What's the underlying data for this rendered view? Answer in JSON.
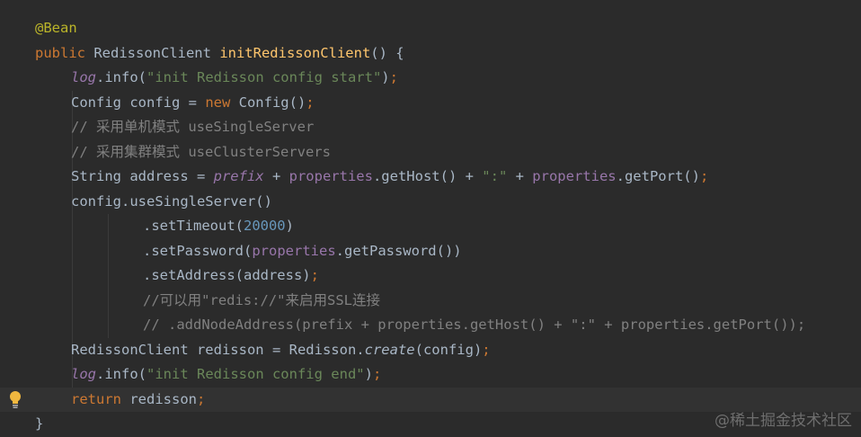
{
  "editor": {
    "lines": [
      {
        "indent": 0,
        "guides": 0,
        "tokens": [
          {
            "t": "@Bean",
            "c": "ann"
          }
        ]
      },
      {
        "indent": 0,
        "guides": 0,
        "tokens": [
          {
            "t": "public ",
            "c": "kw"
          },
          {
            "t": "RedissonClient ",
            "c": "plain"
          },
          {
            "t": "initRedissonClient",
            "c": "fn"
          },
          {
            "t": "() {",
            "c": "plain"
          }
        ]
      },
      {
        "indent": 1,
        "guides": 0,
        "tokens": [
          {
            "t": "log",
            "c": "fldi"
          },
          {
            "t": ".info(",
            "c": "plain"
          },
          {
            "t": "\"init Redisson config start\"",
            "c": "str"
          },
          {
            "t": ")",
            "c": "plain"
          },
          {
            "t": ";",
            "c": "kw"
          }
        ]
      },
      {
        "indent": 1,
        "guides": 1,
        "tokens": [
          {
            "t": "Config config = ",
            "c": "plain"
          },
          {
            "t": "new ",
            "c": "kw"
          },
          {
            "t": "Config()",
            "c": "plain"
          },
          {
            "t": ";",
            "c": "kw"
          }
        ]
      },
      {
        "indent": 1,
        "guides": 1,
        "tokens": [
          {
            "t": "// 采用单机模式 useSingleServer",
            "c": "cmt"
          }
        ]
      },
      {
        "indent": 1,
        "guides": 1,
        "tokens": [
          {
            "t": "// 采用集群模式 useClusterServers",
            "c": "cmt"
          }
        ]
      },
      {
        "indent": 1,
        "guides": 1,
        "tokens": [
          {
            "t": "String address = ",
            "c": "plain"
          },
          {
            "t": "prefix",
            "c": "fldi"
          },
          {
            "t": " + ",
            "c": "plain"
          },
          {
            "t": "properties",
            "c": "fld"
          },
          {
            "t": ".getHost() + ",
            "c": "plain"
          },
          {
            "t": "\":\"",
            "c": "str"
          },
          {
            "t": " + ",
            "c": "plain"
          },
          {
            "t": "properties",
            "c": "fld"
          },
          {
            "t": ".getPort()",
            "c": "plain"
          },
          {
            "t": ";",
            "c": "kw"
          }
        ]
      },
      {
        "indent": 1,
        "guides": 1,
        "tokens": [
          {
            "t": "config.useSingleServer()",
            "c": "plain"
          }
        ]
      },
      {
        "indent": 3,
        "guides": 2,
        "tokens": [
          {
            "t": ".setTimeout(",
            "c": "plain"
          },
          {
            "t": "20000",
            "c": "num"
          },
          {
            "t": ")",
            "c": "plain"
          }
        ]
      },
      {
        "indent": 3,
        "guides": 2,
        "tokens": [
          {
            "t": ".setPassword(",
            "c": "plain"
          },
          {
            "t": "properties",
            "c": "fld"
          },
          {
            "t": ".getPassword())",
            "c": "plain"
          }
        ]
      },
      {
        "indent": 3,
        "guides": 2,
        "tokens": [
          {
            "t": ".setAddress(address)",
            "c": "plain"
          },
          {
            "t": ";",
            "c": "kw"
          }
        ]
      },
      {
        "indent": 3,
        "guides": 2,
        "tokens": [
          {
            "t": "//可以用\"redis://\"来启用SSL连接",
            "c": "cmt"
          }
        ]
      },
      {
        "indent": 3,
        "guides": 2,
        "tokens": [
          {
            "t": "// .addNodeAddress(prefix + properties.getHost() + \":\" + properties.getPort());",
            "c": "cmt"
          }
        ]
      },
      {
        "indent": 1,
        "guides": 1,
        "tokens": [
          {
            "t": "RedissonClient redisson = Redisson.",
            "c": "plain"
          },
          {
            "t": "create",
            "c": "sti"
          },
          {
            "t": "(config)",
            "c": "plain"
          },
          {
            "t": ";",
            "c": "kw"
          }
        ]
      },
      {
        "indent": 1,
        "guides": 1,
        "tokens": [
          {
            "t": "log",
            "c": "fldi"
          },
          {
            "t": ".info(",
            "c": "plain"
          },
          {
            "t": "\"init Redisson config end\"",
            "c": "str"
          },
          {
            "t": ")",
            "c": "plain"
          },
          {
            "t": ";",
            "c": "kw"
          }
        ]
      },
      {
        "indent": 1,
        "guides": 0,
        "current": true,
        "bulb": true,
        "tokens": [
          {
            "t": "return ",
            "c": "kw"
          },
          {
            "t": "redisson",
            "c": "plain"
          },
          {
            "t": ";",
            "c": "kw"
          }
        ]
      },
      {
        "indent": 0,
        "guides": 0,
        "tokens": [
          {
            "t": "}",
            "c": "plain"
          }
        ]
      }
    ]
  },
  "watermark": "@稀土掘金技术社区",
  "icons": {
    "intention_bulb": "lightbulb-icon"
  }
}
